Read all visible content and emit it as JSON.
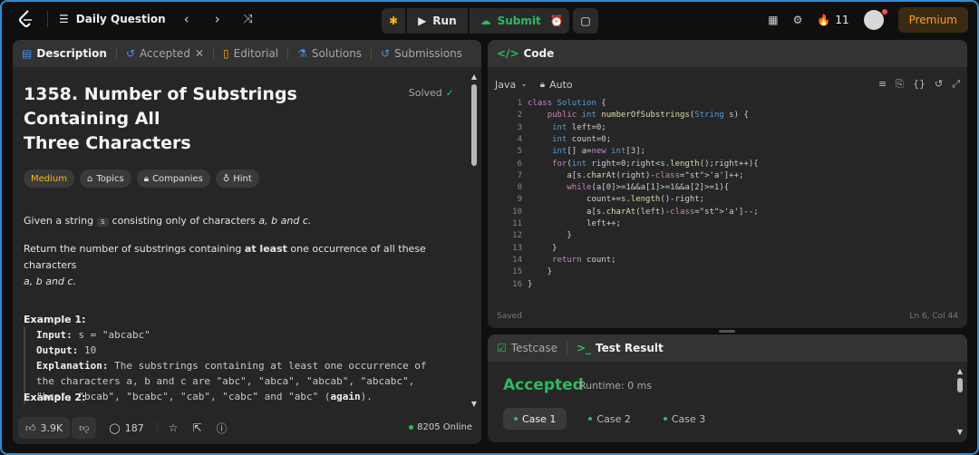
{
  "topbar": {
    "daily_question": "Daily Question",
    "run_label": "Run",
    "submit_label": "Submit",
    "streak_count": "11",
    "premium_label": "Premium"
  },
  "description_panel": {
    "tabs": [
      "Description",
      "Accepted",
      "Editorial",
      "Solutions",
      "Submissions"
    ],
    "title_line1": "1358. Number of Substrings Containing All",
    "title_line2": "Three Characters",
    "solved_label": "Solved",
    "tags": [
      "Medium",
      "Topics",
      "Companies",
      "Hint"
    ],
    "p1_before": "Given a string ",
    "p1_code": "s",
    "p1_after": " consisting only of characters ",
    "p1_chars": "a, b and c.",
    "p2_before": "Return the number of substrings containing ",
    "p2_bold": "at least",
    "p2_after": " one occurrence of all these characters",
    "p2_line2": "a, b and c.",
    "example1_heading": "Example 1:",
    "input_label": "Input:",
    "input_value": " s = \"abcabc\"",
    "output_label": "Output:",
    "output_value": " 10",
    "explanation_label": "Explanation:",
    "explanation_line1": " The substrings containing at least one occurrence of",
    "explanation_line2": "the characters a, b and c are \"abc\", \"abca\", \"abcab\", \"abcabc\",",
    "explanation_line3": "\"bca\", \"bcab\", \"bcabc\", \"cab\", \"cabc\" and \"abc\" (",
    "explanation_again": "again",
    "explanation_end": ").",
    "example2_heading": "Example 2:",
    "likes": "3.9K",
    "comments": "187",
    "online": "8205 Online"
  },
  "code_panel": {
    "tab_label": "Code",
    "language": "Java",
    "mode": "Auto",
    "lines": [
      "class Solution {",
      "    public int numberOfSubstrings(String s) {",
      "     int left=0;",
      "     int count=0;",
      "     int[] a=new int[3];",
      "     for(int right=0;right<s.length();right++){",
      "        a[s.charAt(right)-'a']++;",
      "        while(a[0]>=1&&a[1]>=1&&a[2]>=1){",
      "            count+=s.length()-right;",
      "            a[s.charAt(left)-'a']--;",
      "            left++;",
      "        }",
      "     }",
      "     return count;",
      "    }",
      "}"
    ],
    "saved_label": "Saved",
    "cursor_position": "Ln 6, Col 44"
  },
  "test_panel": {
    "testcase_tab": "Testcase",
    "result_tab": "Test Result",
    "status": "Accepted",
    "runtime": "Runtime: 0 ms",
    "cases": [
      "Case 1",
      "Case 2",
      "Case 3"
    ]
  },
  "colors": {
    "accent_green": "#2cbb5d",
    "medium_yellow": "#ffb800",
    "premium_orange": "#ffa116",
    "frame_blue": "#2b8fd6"
  }
}
